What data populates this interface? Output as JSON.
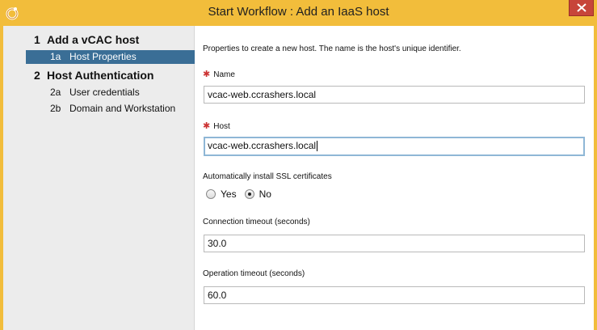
{
  "window": {
    "title": "Start Workflow : Add an IaaS host"
  },
  "sidebar": {
    "steps": [
      {
        "num": "1",
        "label": "Add a vCAC host"
      },
      {
        "num": "2",
        "label": "Host Authentication"
      }
    ],
    "substeps": [
      {
        "num": "1a",
        "label": "Host Properties",
        "active": true
      },
      {
        "num": "2a",
        "label": "User credentials",
        "active": false
      },
      {
        "num": "2b",
        "label": "Domain and Workstation",
        "active": false
      }
    ]
  },
  "form": {
    "description": "Properties  to create a new host. The name is the host's unique identifier.",
    "name": {
      "label": "Name",
      "value": "vcac-web.ccrashers.local",
      "required": true
    },
    "host": {
      "label": "Host",
      "value": "vcac-web.ccrashers.local",
      "required": true
    },
    "ssl": {
      "label": "Automatically install SSL certificates",
      "options": [
        "Yes",
        "No"
      ],
      "selected": "No"
    },
    "connection_timeout": {
      "label": "Connection timeout (seconds)",
      "value": "30.0"
    },
    "operation_timeout": {
      "label": "Operation timeout (seconds)",
      "value": "60.0"
    }
  },
  "colors": {
    "title_bar": "#f2bd3b",
    "close_button": "#c7453a",
    "active_step": "#3a6e96",
    "required_star": "#cc3333"
  },
  "icons": {
    "app": "workflow-app-icon",
    "close": "close-icon"
  }
}
